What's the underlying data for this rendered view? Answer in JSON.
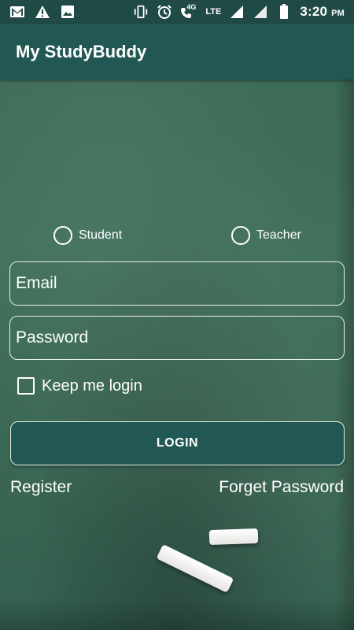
{
  "status_bar": {
    "time": "3:20",
    "ampm": "PM",
    "network_label": "LTE",
    "network_4g": "4G",
    "icons_left": [
      "gmail-icon",
      "warning-icon",
      "image-icon"
    ],
    "icons_right": [
      "vibrate-icon",
      "alarm-icon",
      "call-4g-icon",
      "signal-icon",
      "battery-icon"
    ]
  },
  "app_bar": {
    "title": "My StudyBuddy"
  },
  "login_form": {
    "role_options": [
      {
        "label": "Student",
        "selected": false
      },
      {
        "label": "Teacher",
        "selected": false
      }
    ],
    "email": {
      "placeholder": "Email",
      "value": ""
    },
    "password": {
      "placeholder": "Password",
      "value": ""
    },
    "keep_login": {
      "label": "Keep me login",
      "checked": false
    },
    "login_button": "LOGIN",
    "register_link": "Register",
    "forget_password_link": "Forget Password"
  },
  "colors": {
    "primary": "#215853",
    "status_bar": "#1f4a45",
    "chalkboard": "#3d6b58",
    "text": "#ffffff"
  }
}
